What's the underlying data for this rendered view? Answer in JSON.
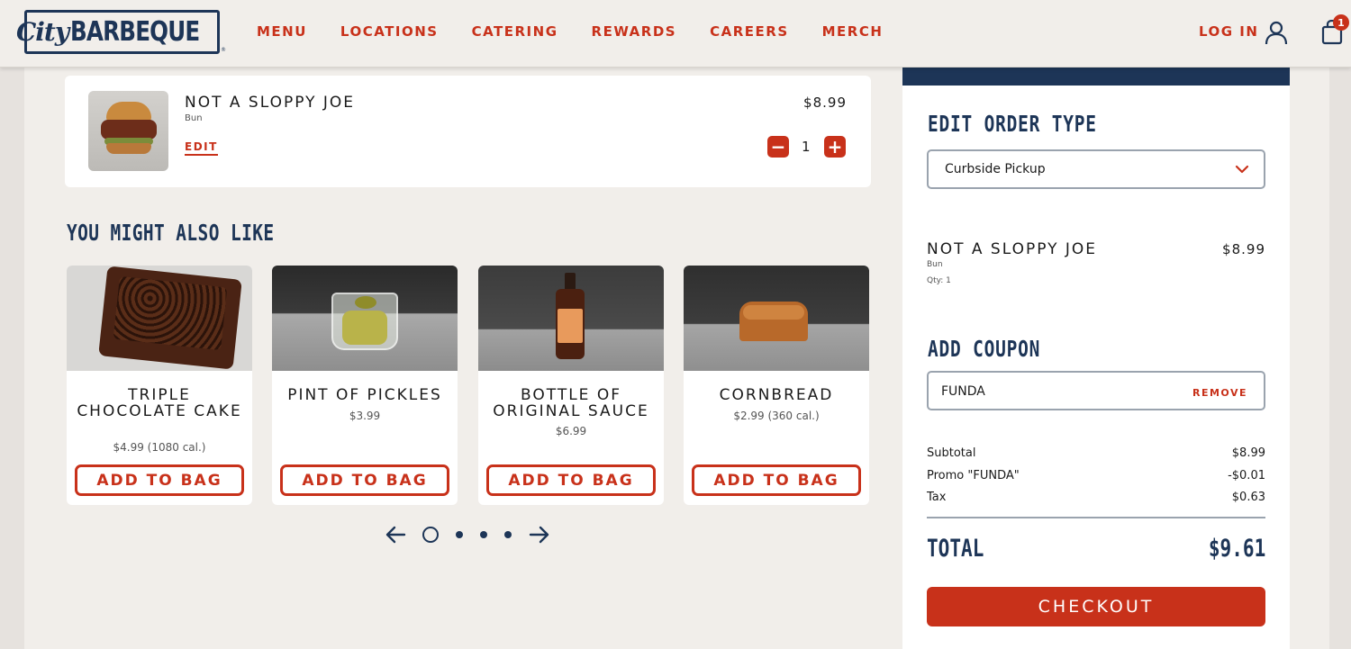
{
  "header": {
    "logo_city": "City",
    "logo_bbq": "BARBEQUE",
    "logo_tm": "®",
    "nav": [
      "MENU",
      "LOCATIONS",
      "CATERING",
      "REWARDS",
      "CAREERS",
      "MERCH"
    ],
    "login": "LOG IN",
    "bag_count": "1",
    "accent_color": "#c8311a",
    "brand_color": "#1d3557"
  },
  "cart_item": {
    "name": "NOT A SLOPPY JOE",
    "sub": "Bun",
    "edit": "EDIT",
    "price": "$8.99",
    "quantity": "1",
    "minus": "−",
    "plus": "+"
  },
  "suggestions": {
    "title": "YOU MIGHT ALSO LIKE",
    "items": [
      {
        "name": "TRIPLE CHOCOLATE CAKE",
        "price": "$4.99 (1080 cal.)",
        "button": "ADD TO BAG"
      },
      {
        "name": "PINT OF PICKLES",
        "price": "$3.99",
        "button": "ADD TO BAG"
      },
      {
        "name": "BOTTLE OF ORIGINAL SAUCE",
        "price": "$6.99",
        "button": "ADD TO BAG"
      },
      {
        "name": "CORNBREAD",
        "price": "$2.99 (360 cal.)",
        "button": "ADD TO BAG"
      }
    ],
    "carousel_pages": 4,
    "carousel_active": 1
  },
  "sidebar": {
    "order_type_title": "EDIT ORDER TYPE",
    "order_type_value": "Curbside Pickup",
    "item_name": "NOT A SLOPPY JOE",
    "item_price": "$8.99",
    "item_sub": "Bun",
    "item_qty": "Qty: 1",
    "coupon_title": "ADD COUPON",
    "coupon_value": "FUNDA",
    "coupon_remove": "REMOVE",
    "subtotal_label": "Subtotal",
    "subtotal_value": "$8.99",
    "promo_label": "Promo \"FUNDA\"",
    "promo_value": "-$0.01",
    "tax_label": "Tax",
    "tax_value": "$0.63",
    "total_label": "TOTAL",
    "total_value": "$9.61",
    "checkout": "CHECKOUT"
  }
}
